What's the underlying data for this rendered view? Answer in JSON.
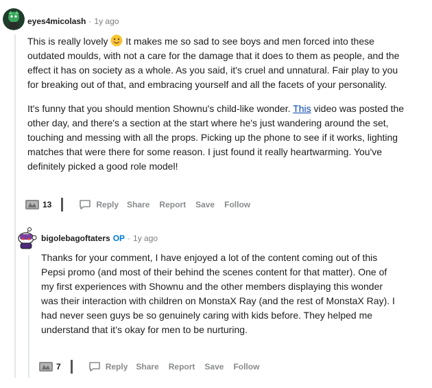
{
  "comment": {
    "username": "eyes4micolash",
    "time_separator": "·",
    "time": "1y ago",
    "paragraph1_before_emoji": "This is really lovely ",
    "paragraph1_after_emoji": " It makes me so sad to see boys and men forced into these outdated moulds, with not a care for the damage that it does to them as people, and the effect it has on society as a whole. As you said, it's cruel and unnatural. Fair play to you for breaking out of that, and embracing yourself and all the facets of your personality.",
    "paragraph2_before_link": "It's funny that you should mention Shownu's child-like wonder. ",
    "paragraph2_link": "This",
    "paragraph2_after_link": " video was posted the other day, and there's a section at the start where he's just wandering around the set, touching and messing with all the props. Picking up the phone to see if it works, lighting matches that were there for some reason. I just found it really heartwarming. You've definitely picked a good role model!",
    "award_count": "13",
    "actions": {
      "reply": "Reply",
      "share": "Share",
      "report": "Report",
      "save": "Save",
      "follow": "Follow"
    }
  },
  "reply": {
    "username": "bigolebagoftaters",
    "op_badge": "OP",
    "time_separator": "·",
    "time": "1y ago",
    "body": "Thanks for your comment, I have enjoyed a lot of the content coming out of this Pepsi promo (and most of their behind the scenes content for that matter). One of my first experiences with Shownu and the other members displaying this wonder was their interaction with children on MonstaX Ray (and the rest of MonstaX Ray). I had never seen guys be so genuinely caring with kids before. They helped me understand that it’s okay for men to be nurturing.",
    "award_count": "7",
    "actions": {
      "reply": "Reply",
      "share": "Share",
      "report": "Report",
      "save": "Save",
      "follow": "Follow"
    }
  },
  "colors": {
    "op_badge": "#0079d3",
    "link": "#0645ad",
    "action_text": "#878a8c",
    "thread_line": "#e3e6e8"
  }
}
